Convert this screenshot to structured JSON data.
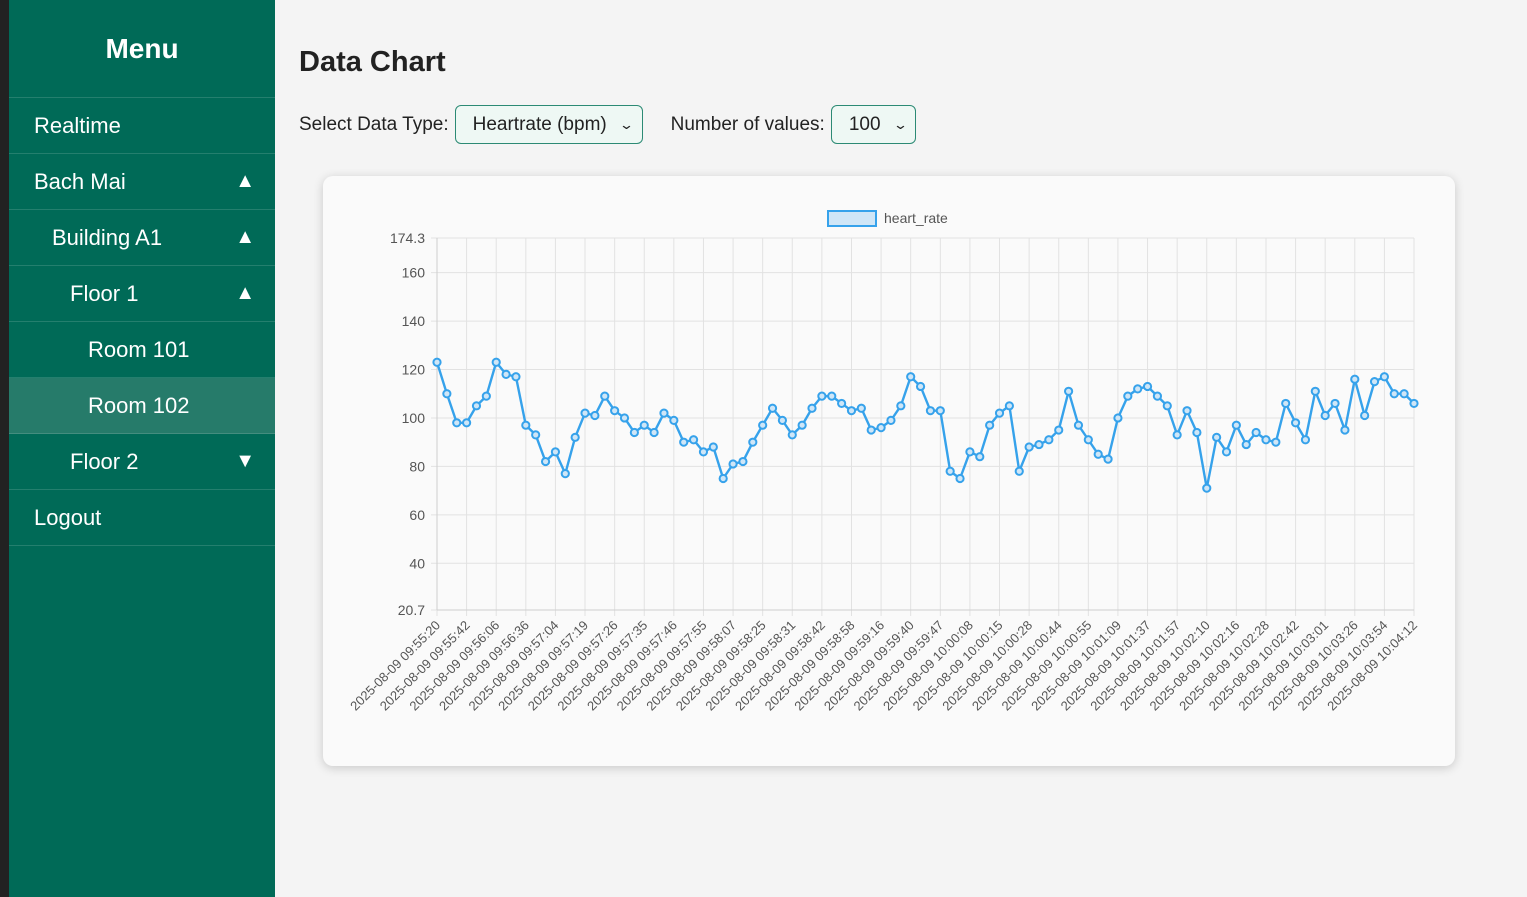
{
  "sidebar": {
    "title": "Menu",
    "items": [
      {
        "label": "Realtime",
        "arrow": "",
        "level": 0,
        "active": false
      },
      {
        "label": "Bach Mai",
        "arrow": "▲",
        "level": 0,
        "active": false
      },
      {
        "label": "Building A1",
        "arrow": "▲",
        "level": 1,
        "active": false
      },
      {
        "label": "Floor 1",
        "arrow": "▲",
        "level": 2,
        "active": false
      },
      {
        "label": "Room 101",
        "arrow": "",
        "level": 3,
        "active": false
      },
      {
        "label": "Room 102",
        "arrow": "",
        "level": 3,
        "active": true
      },
      {
        "label": "Floor 2",
        "arrow": "▼",
        "level": 2,
        "active": false
      },
      {
        "label": "Logout",
        "arrow": "",
        "level": 0,
        "active": false
      }
    ]
  },
  "main": {
    "title": "Data Chart",
    "data_type_label": "Select Data Type:",
    "data_type_value": "Heartrate (bpm)",
    "count_label": "Number of values:",
    "count_value": "100"
  },
  "colors": {
    "sidebar": "#006a57",
    "active_item": "#267b6a",
    "line": "#36a2eb",
    "legend_fill": "#cfe6f7"
  },
  "icons": {
    "dropdown": "chevron-down-icon",
    "expand": "triangle-up-icon",
    "collapse": "triangle-down-icon"
  },
  "chart_data": {
    "type": "line",
    "legend": "heart_rate",
    "ylim": [
      20.7,
      174.3
    ],
    "y_ticks": [
      "174.3",
      "160",
      "140",
      "120",
      "100",
      "80",
      "60",
      "40",
      "20.7"
    ],
    "x_tick_labels": [
      "2025-08-09 09:55:20",
      "2025-08-09 09:55:42",
      "2025-08-09 09:56:06",
      "2025-08-09 09:56:36",
      "2025-08-09 09:57:04",
      "2025-08-09 09:57:19",
      "2025-08-09 09:57:26",
      "2025-08-09 09:57:35",
      "2025-08-09 09:57:46",
      "2025-08-09 09:57:55",
      "2025-08-09 09:58:07",
      "2025-08-09 09:58:25",
      "2025-08-09 09:58:31",
      "2025-08-09 09:58:42",
      "2025-08-09 09:58:58",
      "2025-08-09 09:59:16",
      "2025-08-09 09:59:40",
      "2025-08-09 09:59:47",
      "2025-08-09 10:00:08",
      "2025-08-09 10:00:15",
      "2025-08-09 10:00:28",
      "2025-08-09 10:00:44",
      "2025-08-09 10:00:55",
      "2025-08-09 10:01:09",
      "2025-08-09 10:01:37",
      "2025-08-09 10:01:57",
      "2025-08-09 10:02:10",
      "2025-08-09 10:02:16",
      "2025-08-09 10:02:28",
      "2025-08-09 10:02:42",
      "2025-08-09 10:03:01",
      "2025-08-09 10:03:26",
      "2025-08-09 10:03:54",
      "2025-08-09 10:04:12"
    ],
    "series": [
      {
        "name": "heart_rate",
        "values": [
          123,
          110,
          98,
          98,
          105,
          109,
          123,
          118,
          117,
          97,
          93,
          82,
          86,
          77,
          92,
          102,
          101,
          109,
          103,
          100,
          94,
          97,
          94,
          102,
          99,
          90,
          91,
          86,
          88,
          75,
          81,
          82,
          90,
          97,
          104,
          99,
          93,
          97,
          104,
          109,
          109,
          106,
          103,
          104,
          95,
          96,
          99,
          105,
          117,
          113,
          103,
          103,
          78,
          75,
          86,
          84,
          97,
          102,
          105,
          78,
          88,
          89,
          91,
          95,
          111,
          97,
          91,
          85,
          83,
          100,
          109,
          112,
          113,
          109,
          105,
          93,
          103,
          94,
          71,
          92,
          86,
          97,
          89,
          94,
          91,
          90,
          106,
          98,
          91,
          111,
          101,
          106,
          95,
          116,
          101,
          115,
          117,
          110,
          110,
          106
        ]
      }
    ],
    "grid": true,
    "legend_position": "top"
  }
}
